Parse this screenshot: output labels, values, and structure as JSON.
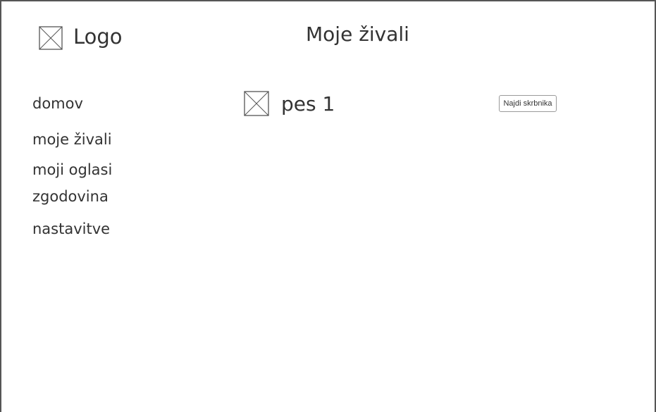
{
  "header": {
    "logo_label": "Logo",
    "title": "Moje živali"
  },
  "sidebar": {
    "items": [
      {
        "label": "domov"
      },
      {
        "label": "moje živali"
      },
      {
        "label": "moji oglasi"
      },
      {
        "label": "zgodovina"
      },
      {
        "label": "nastavitve"
      }
    ]
  },
  "main": {
    "pets": [
      {
        "name": "pes 1",
        "action_label": "Najdi skrbnika",
        "image_icon": "image-placeholder-icon"
      }
    ]
  },
  "icons": {
    "logo": "image-placeholder-icon"
  },
  "colors": {
    "text": "#333333",
    "border": "#555555",
    "button_border": "#9a9a9a"
  }
}
